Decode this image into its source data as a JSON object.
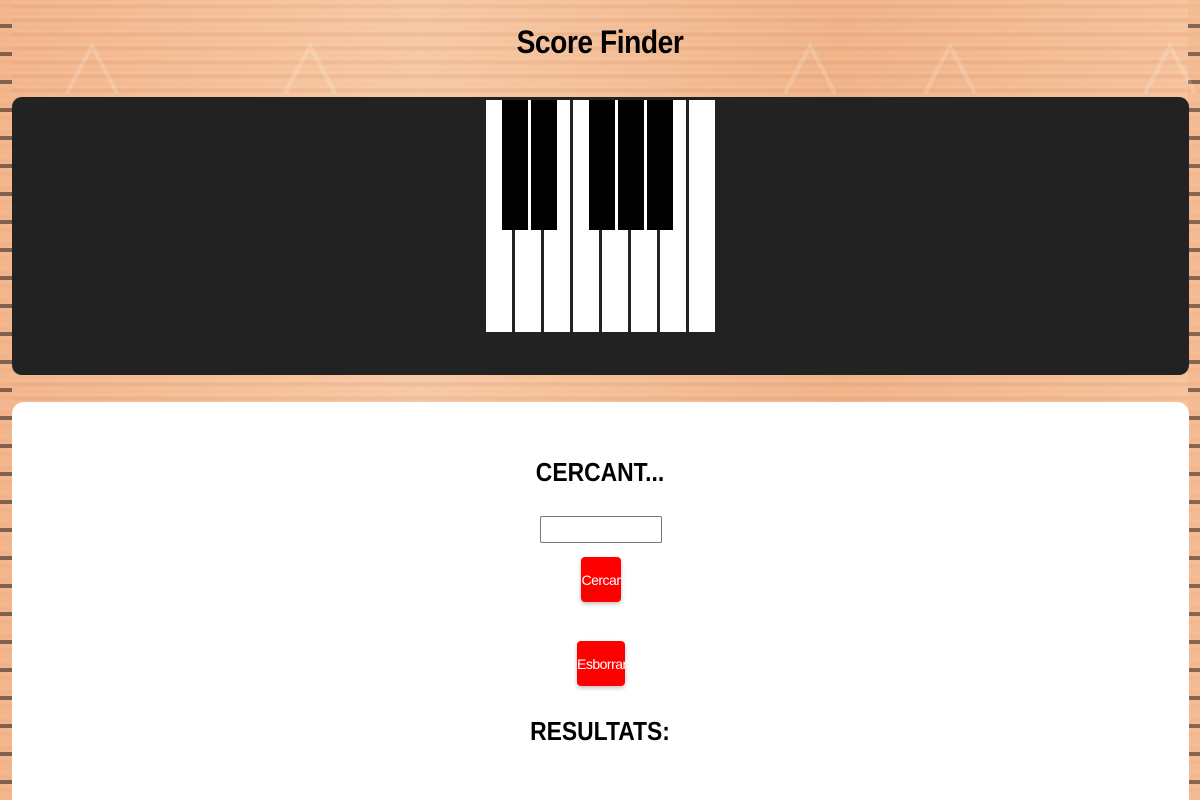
{
  "header": {
    "title": "Score Finder"
  },
  "piano": {
    "white_keys": 8,
    "black_keys": 5,
    "white_color": "#ffffff",
    "black_color": "#000000",
    "panel_color": "#222222"
  },
  "search": {
    "heading": "CERCANT...",
    "input_value": "",
    "input_placeholder": "",
    "search_button_label": "Cercar",
    "clear_button_label": "Esborrar",
    "button_color": "#ff0000"
  },
  "results": {
    "heading": "RESULTATS:"
  }
}
